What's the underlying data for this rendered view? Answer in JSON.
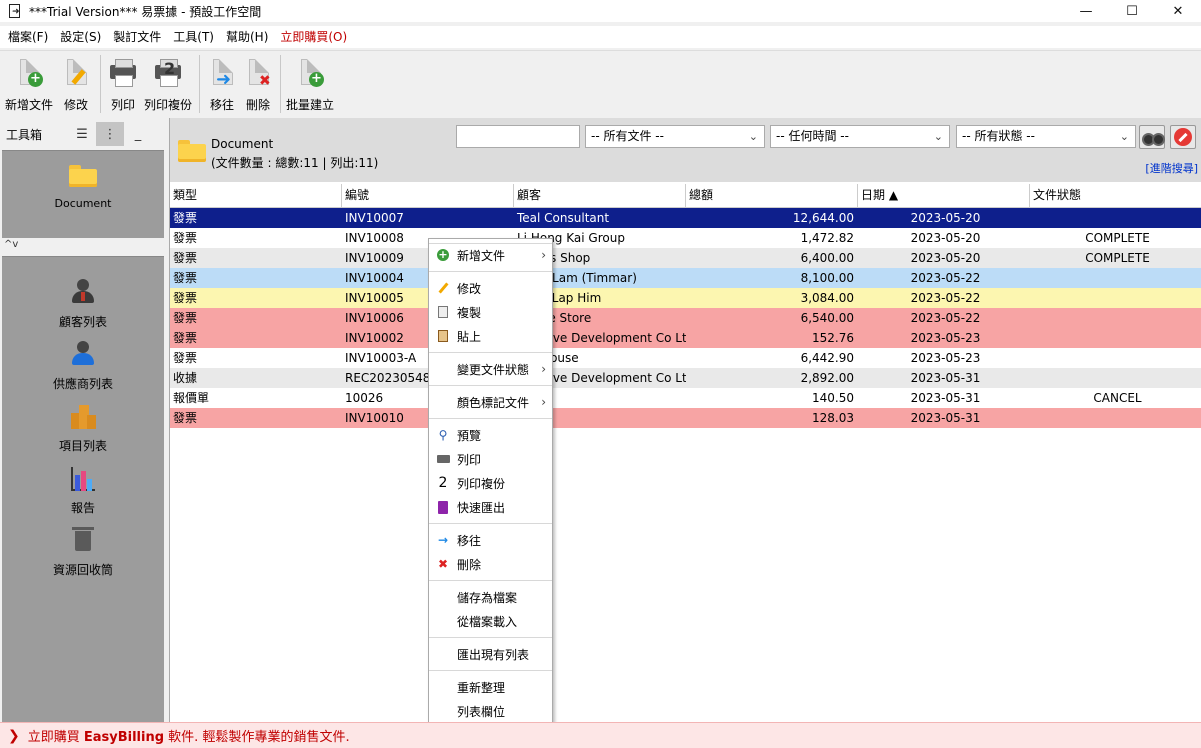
{
  "window": {
    "title": "***Trial Version*** 易票據 - 預設工作空間",
    "minimize": "—",
    "maximize": "☐",
    "close": "✕"
  },
  "menu": [
    "檔案(F)",
    "設定(S)",
    "製訂文件",
    "工具(T)",
    "幫助(H)",
    "立即購買(O)"
  ],
  "toolbar": {
    "new": "新增文件",
    "edit": "修改",
    "print": "列印",
    "print_copies": "列印複份",
    "move": "移往",
    "delete": "刪除",
    "batch": "批量建立"
  },
  "sidebar": {
    "title": "工具箱",
    "top_item": "Document",
    "split": "^v",
    "nav": [
      "顧客列表",
      "供應商列表",
      "項目列表",
      "報告",
      "資源回收筒"
    ]
  },
  "filters": {
    "doc_title": "Document",
    "doc_count": "(文件數量 : 總數:11 | 列出:11)",
    "search_value": "",
    "all_docs": "-- 所有文件 --",
    "any_time": "-- 任何時間 --",
    "all_status": "-- 所有狀態 --",
    "advanced": "[進階搜尋]"
  },
  "columns": [
    "類型",
    "編號",
    "顧客",
    "總額",
    "日期 ▲",
    "文件狀態"
  ],
  "rows": [
    {
      "type": "發票",
      "no": "INV10007",
      "customer": "Teal Consultant",
      "total": "12,644.00",
      "date": "2023-05-20",
      "status": "",
      "bg": "#0e1f8c",
      "fg": "#ffffff"
    },
    {
      "type": "發票",
      "no": "INV10008",
      "customer": "Li Hong Kai Group",
      "total": "1,472.82",
      "date": "2023-05-20",
      "status": "COMPLETE",
      "bg": "#ffffff",
      "fg": "#000000"
    },
    {
      "type": "發票",
      "no": "INV10009",
      "customer": "Mary's Shop",
      "total": "6,400.00",
      "date": "2023-05-20",
      "status": "COMPLETE",
      "bg": "#e9e9e9",
      "fg": "#000000"
    },
    {
      "type": "發票",
      "no": "INV10004",
      "customer": "Peter Lam (Timmar)",
      "total": "8,100.00",
      "date": "2023-05-22",
      "status": "",
      "bg": "#bcdcf7",
      "fg": "#000000"
    },
    {
      "type": "發票",
      "no": "INV10005",
      "customer": "Chan Lap Him",
      "total": "3,084.00",
      "date": "2023-05-22",
      "status": "",
      "bg": "#fcf6b0",
      "fg": "#000000"
    },
    {
      "type": "發票",
      "no": "INV10006",
      "customer": "Online Store",
      "total": "6,540.00",
      "date": "2023-05-22",
      "status": "",
      "bg": "#f7a4a4",
      "fg": "#000000"
    },
    {
      "type": "發票",
      "no": "INV10002",
      "customer": "Creative Development Co Ltd",
      "total": "152.76",
      "date": "2023-05-23",
      "status": "",
      "bg": "#f7a4a4",
      "fg": "#000000"
    },
    {
      "type": "發票",
      "no": "INV10003-A",
      "customer": "Top House",
      "total": "6,442.90",
      "date": "2023-05-23",
      "status": "",
      "bg": "#ffffff",
      "fg": "#000000"
    },
    {
      "type": "收據",
      "no": "REC20230548",
      "customer": "Creative Development Co Ltd",
      "total": "2,892.00",
      "date": "2023-05-31",
      "status": "",
      "bg": "#e9e9e9",
      "fg": "#000000"
    },
    {
      "type": "報價單",
      "no": "10026",
      "customer": "",
      "total": "140.50",
      "date": "2023-05-31",
      "status": "CANCEL",
      "bg": "#ffffff",
      "fg": "#000000"
    },
    {
      "type": "發票",
      "no": "INV10010",
      "customer": "",
      "total": "128.03",
      "date": "2023-05-31",
      "status": "",
      "bg": "#f7a4a4",
      "fg": "#000000"
    }
  ],
  "context_menu": {
    "new_doc": "新增文件",
    "edit": "修改",
    "copy": "複製",
    "paste": "貼上",
    "change_status": "變更文件狀態",
    "color_mark": "顏色標記文件",
    "preview": "預覽",
    "print": "列印",
    "print_copies": "列印複份",
    "quick_export": "快速匯出",
    "move": "移往",
    "delete": "刪除",
    "save_as_file": "儲存為檔案",
    "load_from_file": "從檔案載入",
    "export_list": "匯出現有列表",
    "refresh": "重新整理",
    "list_columns": "列表欄位",
    "submenu_arrow": "›"
  },
  "banner": {
    "arrow": "❯",
    "prefix": "立即購買 ",
    "brand": "EasyBilling",
    "suffix": " 軟件. 輕鬆製作專業的銷售文件."
  },
  "colors": {
    "selected_row": "#0e1f8c",
    "red_mark": "#f7a4a4",
    "yellow_mark": "#fcf6b0",
    "blue_mark": "#bcdcf7",
    "buy_red": "#c00000"
  }
}
